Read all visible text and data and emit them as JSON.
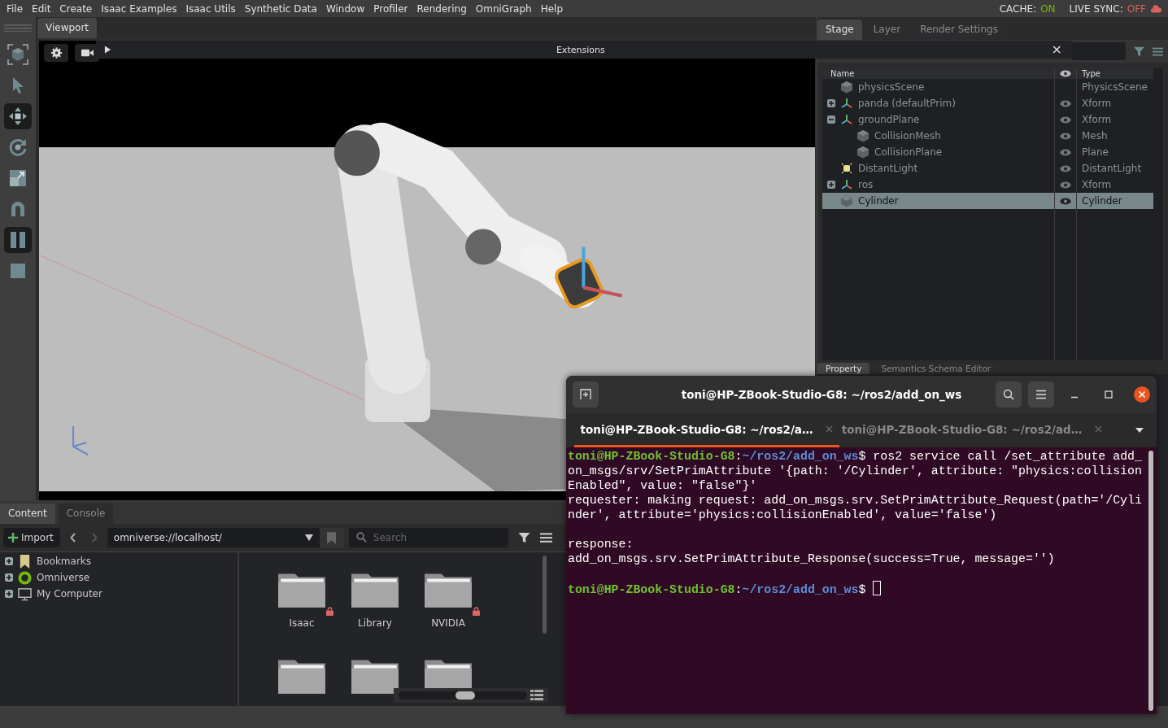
{
  "menu": [
    "File",
    "Edit",
    "Create",
    "Isaac Examples",
    "Isaac Utils",
    "Synthetic Data",
    "Window",
    "Profiler",
    "Rendering",
    "OmniGraph",
    "Help"
  ],
  "status": [
    {
      "label": "CACHE:",
      "value": "ON",
      "on": true
    },
    {
      "label": "LIVE SYNC:",
      "value": "OFF",
      "on": false
    }
  ],
  "toolbar": [
    {
      "kind": "select-cube",
      "selected": false
    },
    {
      "kind": "pointer",
      "selected": false
    },
    {
      "kind": "move",
      "selected": true
    },
    {
      "kind": "rotate",
      "selected": false
    },
    {
      "kind": "scale",
      "selected": false
    },
    {
      "kind": "snap",
      "selected": false
    },
    {
      "kind": "pause",
      "selected": true
    },
    {
      "kind": "stop",
      "selected": false
    }
  ],
  "viewport": {
    "tab": "Viewport",
    "kind": "picture"
  },
  "extensions_bar": {
    "title": "Extensions",
    "close": "×"
  },
  "stage": {
    "tabs": [
      {
        "label": "Stage",
        "selected": true
      },
      {
        "label": "Layer",
        "selected": false
      },
      {
        "label": "Render Settings",
        "selected": false
      }
    ],
    "columns": [
      "Name",
      "Type"
    ],
    "tree": [
      {
        "name": "physicsScene",
        "type": "PhysicsScene",
        "kind": "cube",
        "visible": false,
        "selected": false
      },
      {
        "name": "panda (defaultPrim)",
        "type": "Xform",
        "kind": "xform",
        "visible": true,
        "selected": false,
        "expanded": false
      },
      {
        "name": "groundPlane",
        "type": "Xform",
        "kind": "xform",
        "visible": true,
        "selected": false,
        "expanded": true,
        "children": [
          {
            "name": "CollisionMesh",
            "type": "Mesh",
            "kind": "cube",
            "visible": true,
            "selected": false
          },
          {
            "name": "CollisionPlane",
            "type": "Plane",
            "kind": "cube",
            "visible": true,
            "selected": false
          }
        ]
      },
      {
        "name": "DistantLight",
        "type": "DistantLight",
        "kind": "light",
        "visible": true,
        "selected": false
      },
      {
        "name": "ros",
        "type": "Xform",
        "kind": "xform",
        "visible": true,
        "selected": false,
        "expanded": false
      },
      {
        "name": "Cylinder",
        "type": "Cylinder",
        "kind": "cube",
        "visible": true,
        "selected": true
      }
    ]
  },
  "property_tabs": [
    {
      "label": "Property",
      "selected": true
    },
    {
      "label": "Semantics Schema Editor",
      "selected": false
    }
  ],
  "content": {
    "tabs": [
      {
        "label": "Content",
        "selected": true
      },
      {
        "label": "Console",
        "selected": false
      }
    ],
    "import": "Import",
    "path": "omniverse://localhost/",
    "search": {
      "placeholder": "Search"
    },
    "locations": [
      {
        "label": "Bookmarks",
        "kind": "bookmark"
      },
      {
        "label": "Omniverse",
        "kind": "omniverse"
      },
      {
        "label": "My Computer",
        "kind": "computer"
      }
    ],
    "folders": [
      {
        "kind": "folder",
        "label": "Isaac",
        "locked": true
      },
      {
        "kind": "folder",
        "label": "Library",
        "locked": false
      },
      {
        "kind": "folder",
        "label": "NVIDIA",
        "locked": true
      },
      {
        "kind": "folder"
      },
      {
        "kind": "folder"
      },
      {
        "kind": "folder"
      }
    ],
    "zoom": {
      "kind": "slider"
    }
  },
  "terminal": {
    "title": "toni@HP-ZBook-Studio-G8: ~/ros2/add_on_ws",
    "tabs": [
      {
        "label": "toni@HP-ZBook-Studio-G8: ~/ros2/a…",
        "selected": true
      },
      {
        "label": "toni@HP-ZBook-Studio-G8: ~/ros2/ad…",
        "selected": false
      }
    ],
    "lines": [
      {
        "kind": "prompt",
        "host": "toni@HP-ZBook-Studio-G8",
        "sep": ":",
        "path": "~/ros2/add_on_ws",
        "end": "$",
        "command": "ros2 service call /set_attribute add_on_msgs/srv/SetPrimAttribute '{path: '/Cylinder', attribute: \"physics:collisionEnabled\", value: \"false\"}'"
      },
      {
        "kind": "output",
        "text": "requester: making request: add_on_msgs.srv.SetPrimAttribute_Request(path='/Cylinder', attribute='physics:collisionEnabled', value='false')"
      },
      {
        "kind": "blank"
      },
      {
        "kind": "output",
        "text": "response:"
      },
      {
        "kind": "output",
        "text": "add_on_msgs.srv.SetPrimAttribute_Response(success=True, message='')"
      },
      {
        "kind": "blank"
      },
      {
        "kind": "prompt",
        "host": "toni@HP-ZBook-Studio-G8",
        "sep": ":",
        "path": "~/ros2/add_on_ws",
        "end": "$",
        "cursor": true
      }
    ]
  }
}
